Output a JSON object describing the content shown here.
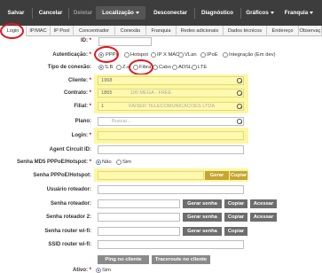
{
  "toolbar": {
    "items": [
      "Salvar",
      "Cancelar",
      "Deletar",
      "Localização",
      "Desconectar",
      "Diagnóstico",
      "Gráficos",
      "Franquia"
    ]
  },
  "tabs": [
    "Login",
    "IP/MAC",
    "IP Pool",
    "Concentrador",
    "Conexão",
    "Franquia",
    "Redes adicionais",
    "Dados técnicos",
    "Endereço",
    "Observaç"
  ],
  "form": {
    "id_label": "ID:",
    "autenticacao_label": "Autenticação:",
    "autenticacao_options": [
      "PPPo",
      "Hotspot",
      "IP X MAC",
      "VLan",
      "IPoE",
      "Integração (Em dev)"
    ],
    "autenticacao_selected": "PPPo",
    "tipo_conexao_label": "Tipo de conexão:",
    "tipo_conexao_options": [
      "S.B",
      "Z.e",
      "Fibra",
      "Cabo",
      "ADSL",
      "LTE"
    ],
    "tipo_conexao_selected": "S.B",
    "cliente_label": "Cliente:",
    "cliente_value": "1968",
    "contrato_label": "Contrato:",
    "contrato_value": "1865",
    "contrato_hint": "100 MEGA - FREE",
    "filial_label": "Filial:",
    "filial_value": "1",
    "filial_hint": "FAISER TELECOMUNICACOES LTDA",
    "plano_label": "Plano:",
    "plano_placeholder": "Buscar...",
    "login_label": "Login:",
    "agent_label": "Agent Circuit ID:",
    "senha_md5_label": "Senha MD5 PPPoE/Hotspot:",
    "senha_md5_options": [
      "Não",
      "Sim"
    ],
    "senha_md5_selected": "Não",
    "senha_pppoe_label": "Senha PPPoE/Hotspot:",
    "usuario_roteador_label": "Usuário roteador:",
    "senha_roteador_label": "Senha roteador:",
    "senha_roteador2_label": "Senha roteador 2:",
    "senha_wifi_label": "Senha router wi-fi:",
    "ssid_label": "SSID router wi-fi:",
    "ativo_label": "Ativo:",
    "ativo_options": [
      "Sim"
    ],
    "required_mark": "*"
  },
  "buttons": {
    "gerar_senha": "Gerar senha",
    "copiar": "Copiar",
    "acessar": "Acessar",
    "ping": "Ping no cliente",
    "traceroute": "Traceroute no cliente"
  },
  "colors": {
    "toolbar_bg": "#3d3d3d",
    "highlight": "#fbf7a2",
    "annotation": "#e0181e",
    "gold_button": "#c7a52f"
  }
}
